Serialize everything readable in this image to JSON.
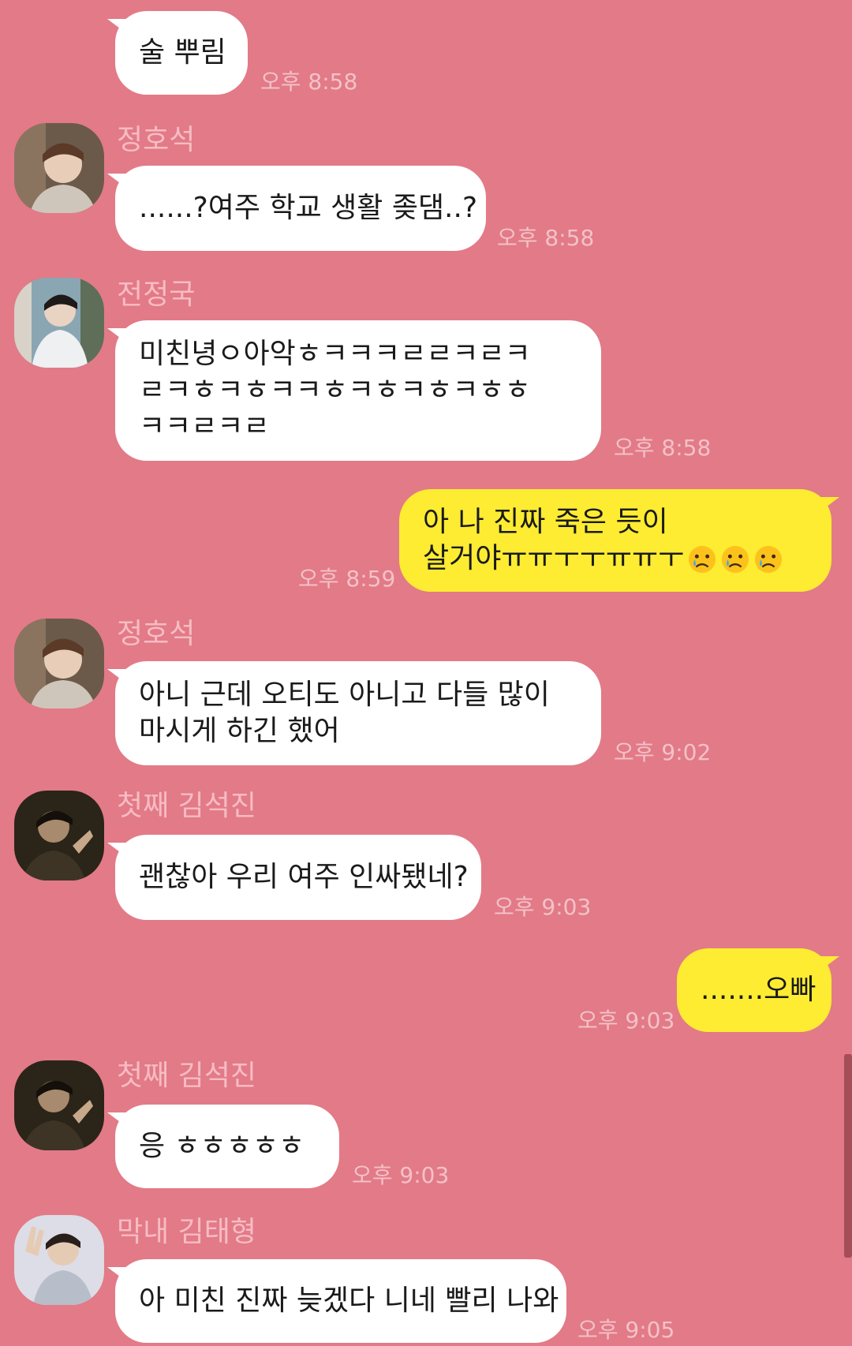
{
  "messages": [
    {
      "sender": "",
      "text": [
        "술 뿌림"
      ],
      "time": "오후 8:58"
    },
    {
      "sender": "정호석",
      "avatar": "avatar-jung-hoseok",
      "text": [
        "......?여주 학교 생활 좆댐..?"
      ],
      "time": "오후 8:58"
    },
    {
      "sender": "전정국",
      "avatar": "avatar-jeon-jungkook",
      "text": [
        "미친녕ㅇ아악ㅎㅋㅋㅋㄹㄹㅋㄹㅋ",
        "ㄹㅋㅎㅋㅎㅋㅋㅎㅋㅎㅋㅎㅋㅎㅎ",
        "ㅋㅋㄹㅋㄹ"
      ],
      "time": "오후 8:58"
    },
    {
      "sender": "",
      "outgoing": true,
      "text": [
        "아 나 진짜 죽은 듯이",
        "살거야ㅠㅠㅜㅜㅠㅠㅜ"
      ],
      "emoji": "crying-face-emoji",
      "emoji_count": 3,
      "time": "오후 8:59"
    },
    {
      "sender": "정호석",
      "avatar": "avatar-jung-hoseok",
      "text": [
        "아니 근데 오티도 아니고 다들 많이",
        "마시게 하긴 했어"
      ],
      "time": "오후 9:02"
    },
    {
      "sender": "첫째 김석진",
      "avatar": "avatar-kim-seokjin",
      "text": [
        "괜찮아 우리 여주 인싸됐네?"
      ],
      "time": "오후 9:03"
    },
    {
      "sender": "",
      "outgoing": true,
      "text": [
        ".......오빠"
      ],
      "time": "오후 9:03"
    },
    {
      "sender": "첫째 김석진",
      "avatar": "avatar-kim-seokjin",
      "text": [
        "응 ㅎㅎㅎㅎㅎ"
      ],
      "time": "오후 9:03"
    },
    {
      "sender": "막내 김태형",
      "avatar": "avatar-kim-taehyung",
      "text": [
        "아 미친 진짜 늦겠다 니네 빨리 나와"
      ],
      "time": "오후 9:05"
    }
  ],
  "colors": {
    "background": "#e37a87",
    "incoming_bubble": "#ffffff",
    "outgoing_bubble": "#fdec32",
    "name_text": "#f6bcc3",
    "time_text": "#f2c2c8"
  }
}
